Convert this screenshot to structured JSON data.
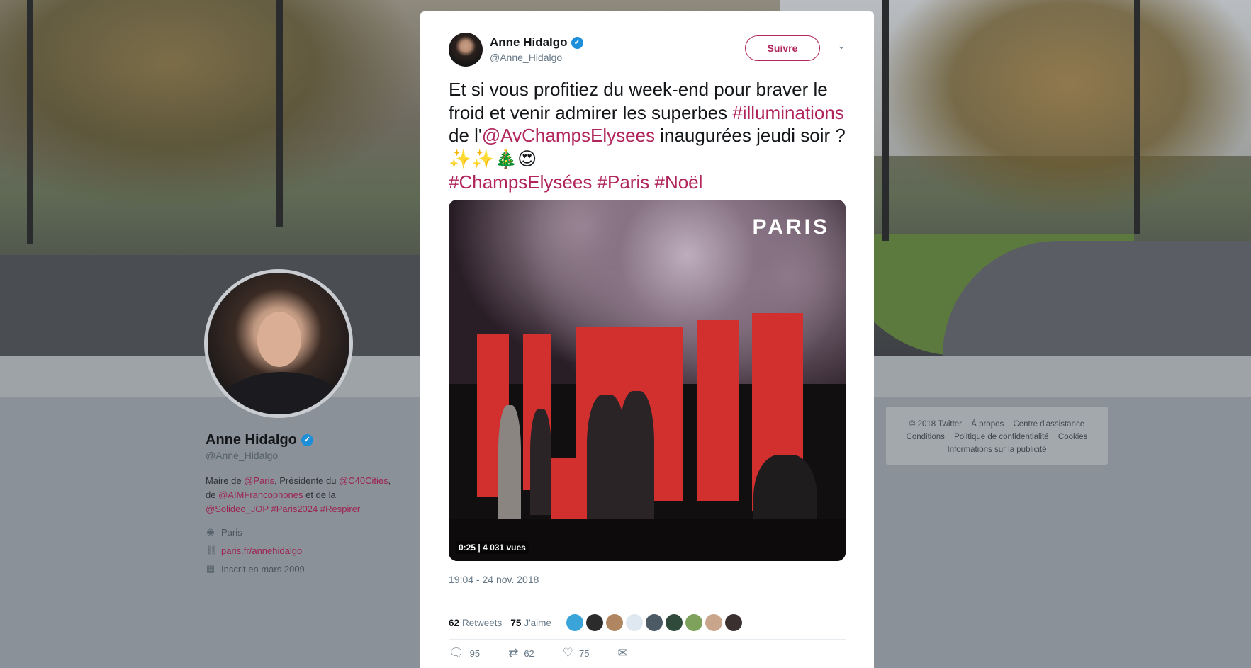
{
  "profile": {
    "name": "Anne Hidalgo",
    "handle": "@Anne_Hidalgo",
    "bio": {
      "p1": "Maire de ",
      "l1": "@Paris",
      "p2": ", Présidente du ",
      "l2": "@C40Cities",
      "p3": ",",
      "p4": "de ",
      "l3": "@AIMFrancophones",
      "p5": " et de la",
      "l4": "@Solideo_JOP",
      "l5": "#Paris2024",
      "l6": "#Respirer"
    },
    "location": "Paris",
    "website": "paris.fr/annehidalgo",
    "joined": "Inscrit en mars 2009",
    "icons": {
      "location": "map-pin-icon",
      "website": "link-icon",
      "joined": "calendar-icon"
    }
  },
  "footer": {
    "row1": [
      "© 2018 Twitter",
      "À propos",
      "Centre d'assistance"
    ],
    "row2": [
      "Conditions",
      "Politique de confidentialité",
      "Cookies"
    ],
    "row3": [
      "Informations sur la publicité"
    ]
  },
  "tweet": {
    "name": "Anne Hidalgo",
    "handle": "@Anne_Hidalgo",
    "follow_label": "Suivre",
    "text": {
      "t1": "Et si vous profitiez du week-end pour braver le froid et venir admirer les superbes ",
      "h1": "#illuminations",
      "t2": " de l'",
      "h2": "@AvChampsElysees",
      "t3": " inaugurées jeudi soir ? ",
      "emoji": "✨✨🎄😍",
      "h3": "#ChampsElysées",
      "h4": "#Paris",
      "h5": "#Noël"
    },
    "video": {
      "watermark": "PARIS",
      "time": "0:25",
      "views": "4 031 vues"
    },
    "timestamp": "19:04 - 24 nov. 2018",
    "retweets_count": "62",
    "retweets_label": "Retweets",
    "likes_count": "75",
    "likes_label": "J'aime",
    "actions": {
      "reply_count": "95",
      "retweet_count": "62",
      "like_count": "75"
    }
  },
  "colors": {
    "accent": "#b0265c",
    "verified": "#1d8fd8",
    "text_secondary": "#657786"
  }
}
